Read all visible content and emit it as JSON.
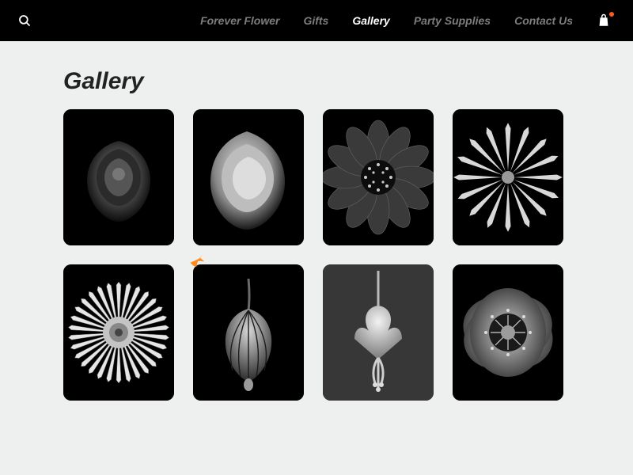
{
  "header": {
    "nav": [
      {
        "label": "Forever Flower",
        "active": false
      },
      {
        "label": "Gifts",
        "active": false
      },
      {
        "label": "Gallery",
        "active": true
      },
      {
        "label": "Party Supplies",
        "active": false
      },
      {
        "label": "Contact Us",
        "active": false
      }
    ],
    "icons": {
      "search": "search-icon",
      "cart": "shopping-bag-icon"
    },
    "cart_badge": true
  },
  "page": {
    "title": "Gallery"
  },
  "gallery": {
    "items": [
      {
        "name": "rose-dark"
      },
      {
        "name": "rose-light"
      },
      {
        "name": "zinnia"
      },
      {
        "name": "water-lily"
      },
      {
        "name": "strawflower"
      },
      {
        "name": "abutilon"
      },
      {
        "name": "fuchsia"
      },
      {
        "name": "poppy"
      }
    ]
  },
  "colors": {
    "bg": "#eef0f0",
    "header": "#000000",
    "nav_inactive": "#7d7d7d",
    "nav_active": "#ffffff",
    "accent": "#ff8a1f"
  }
}
